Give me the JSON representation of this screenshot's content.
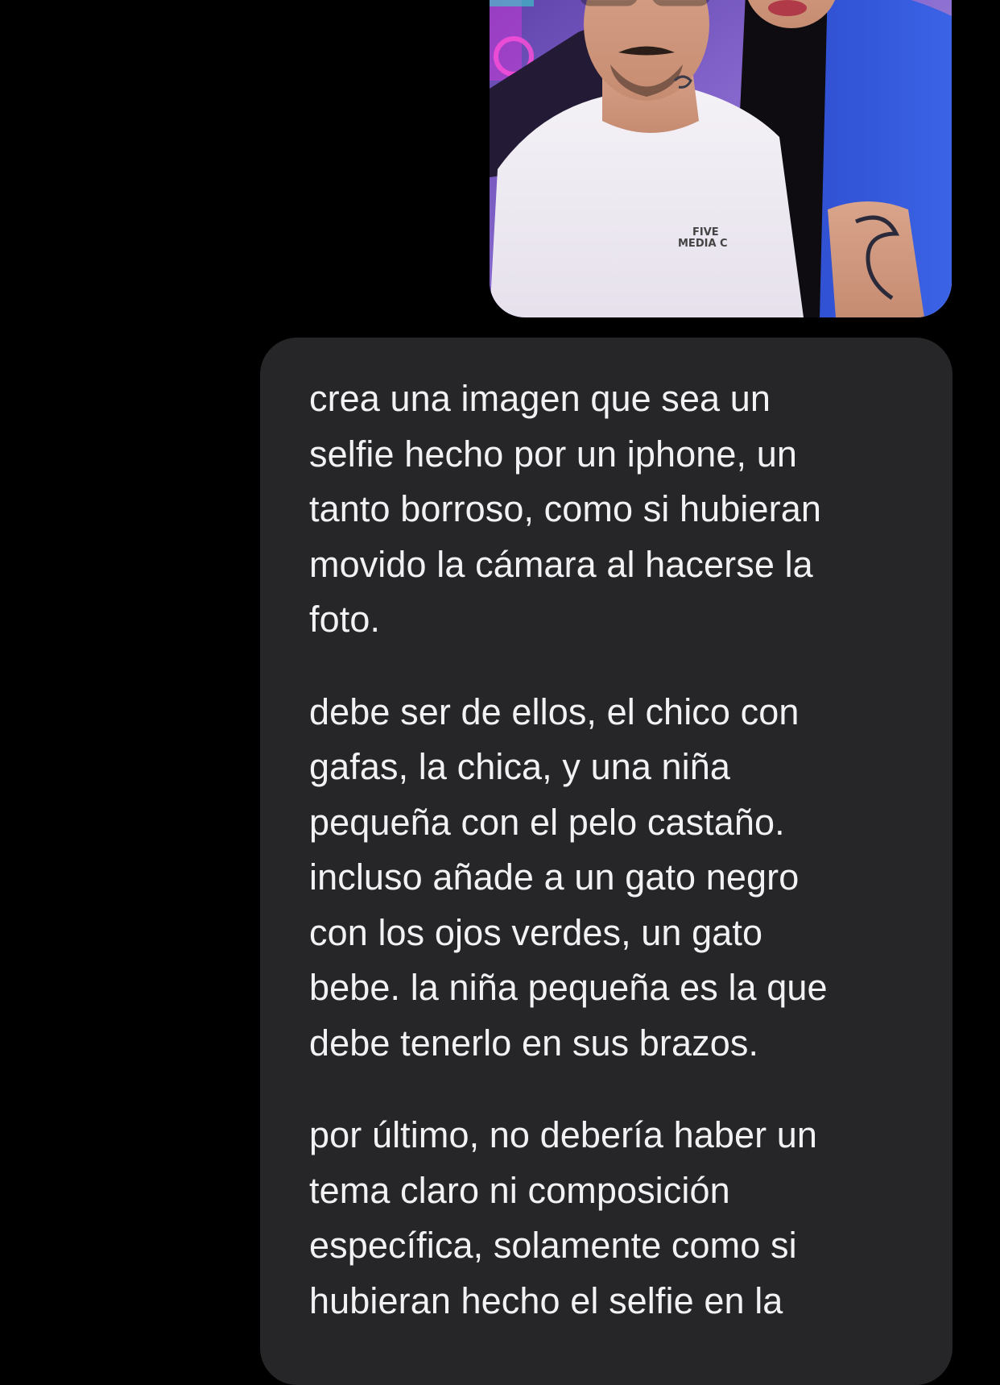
{
  "conversation": {
    "attachment": {
      "kind": "photo",
      "shirt_print_line1": "FIVE",
      "shirt_print_line2": "MEDIA C"
    },
    "message": {
      "paragraphs": [
        "crea una imagen que sea un\nselfie hecho por un iphone, un\ntanto borroso, como si hubieran\nmovido la cámara al hacerse la\nfoto.",
        "debe ser de ellos, el chico con\ngafas, la chica, y una niña\npequeña con el pelo castaño.\nincluso añade a un gato negro\ncon los ojos verdes, un gato\nbebe. la niña pequeña es la que\ndebe tenerlo en sus brazos.",
        "por último, no debería haber un\ntema claro ni composición\nespecífica, solamente como si\nhubieran hecho el selfie en la"
      ]
    }
  },
  "colors": {
    "background": "#000000",
    "bubble": "#262628",
    "text": "#f2f2f4"
  }
}
